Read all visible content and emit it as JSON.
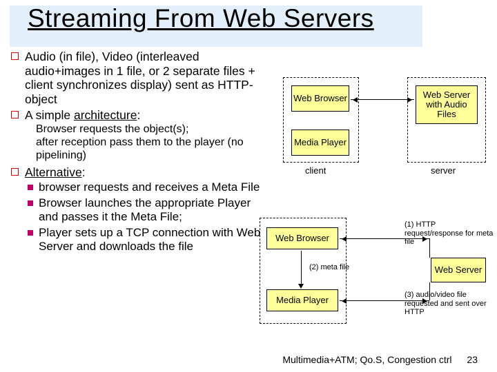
{
  "title": "Streaming From Web Servers",
  "bullets": {
    "b1_line1": "Audio (in file), Video (interleaved",
    "b1_cont": "audio+images in 1 file, or 2 separate files + client synchronizes display) sent as HTTP-object",
    "b2_prefix": "A simple ",
    "b2_under": "architecture",
    "b2_suffix": ":",
    "b2_s1": "Browser requests the object(s);",
    "b2_s2": "after reception pass them to the player (no pipelining)",
    "b3_under": "Alternative",
    "b3_suffix": ":",
    "b3_m1": "browser requests and receives a Meta File",
    "b3_m2": "Browser launches the appropriate Player and passes it the Meta File;",
    "b3_m3": "Player sets up a TCP connection with Web Server and downloads the file"
  },
  "diagram1": {
    "box_browser": "Web Browser",
    "box_player": "Media Player",
    "box_server": "Web Server with Audio Files",
    "cap_client": "client",
    "cap_server": "server"
  },
  "diagram2": {
    "box_browser": "Web Browser",
    "box_player": "Media Player",
    "box_server": "Web Server",
    "annot1": "(1) HTTP request/response for meta file",
    "annot2": "(2) meta file",
    "annot3": "(3) audio/video file requested and sent over HTTP"
  },
  "footer": {
    "text": "Multimedia+ATM; Qo.S, Congestion ctrl",
    "page": "23"
  }
}
